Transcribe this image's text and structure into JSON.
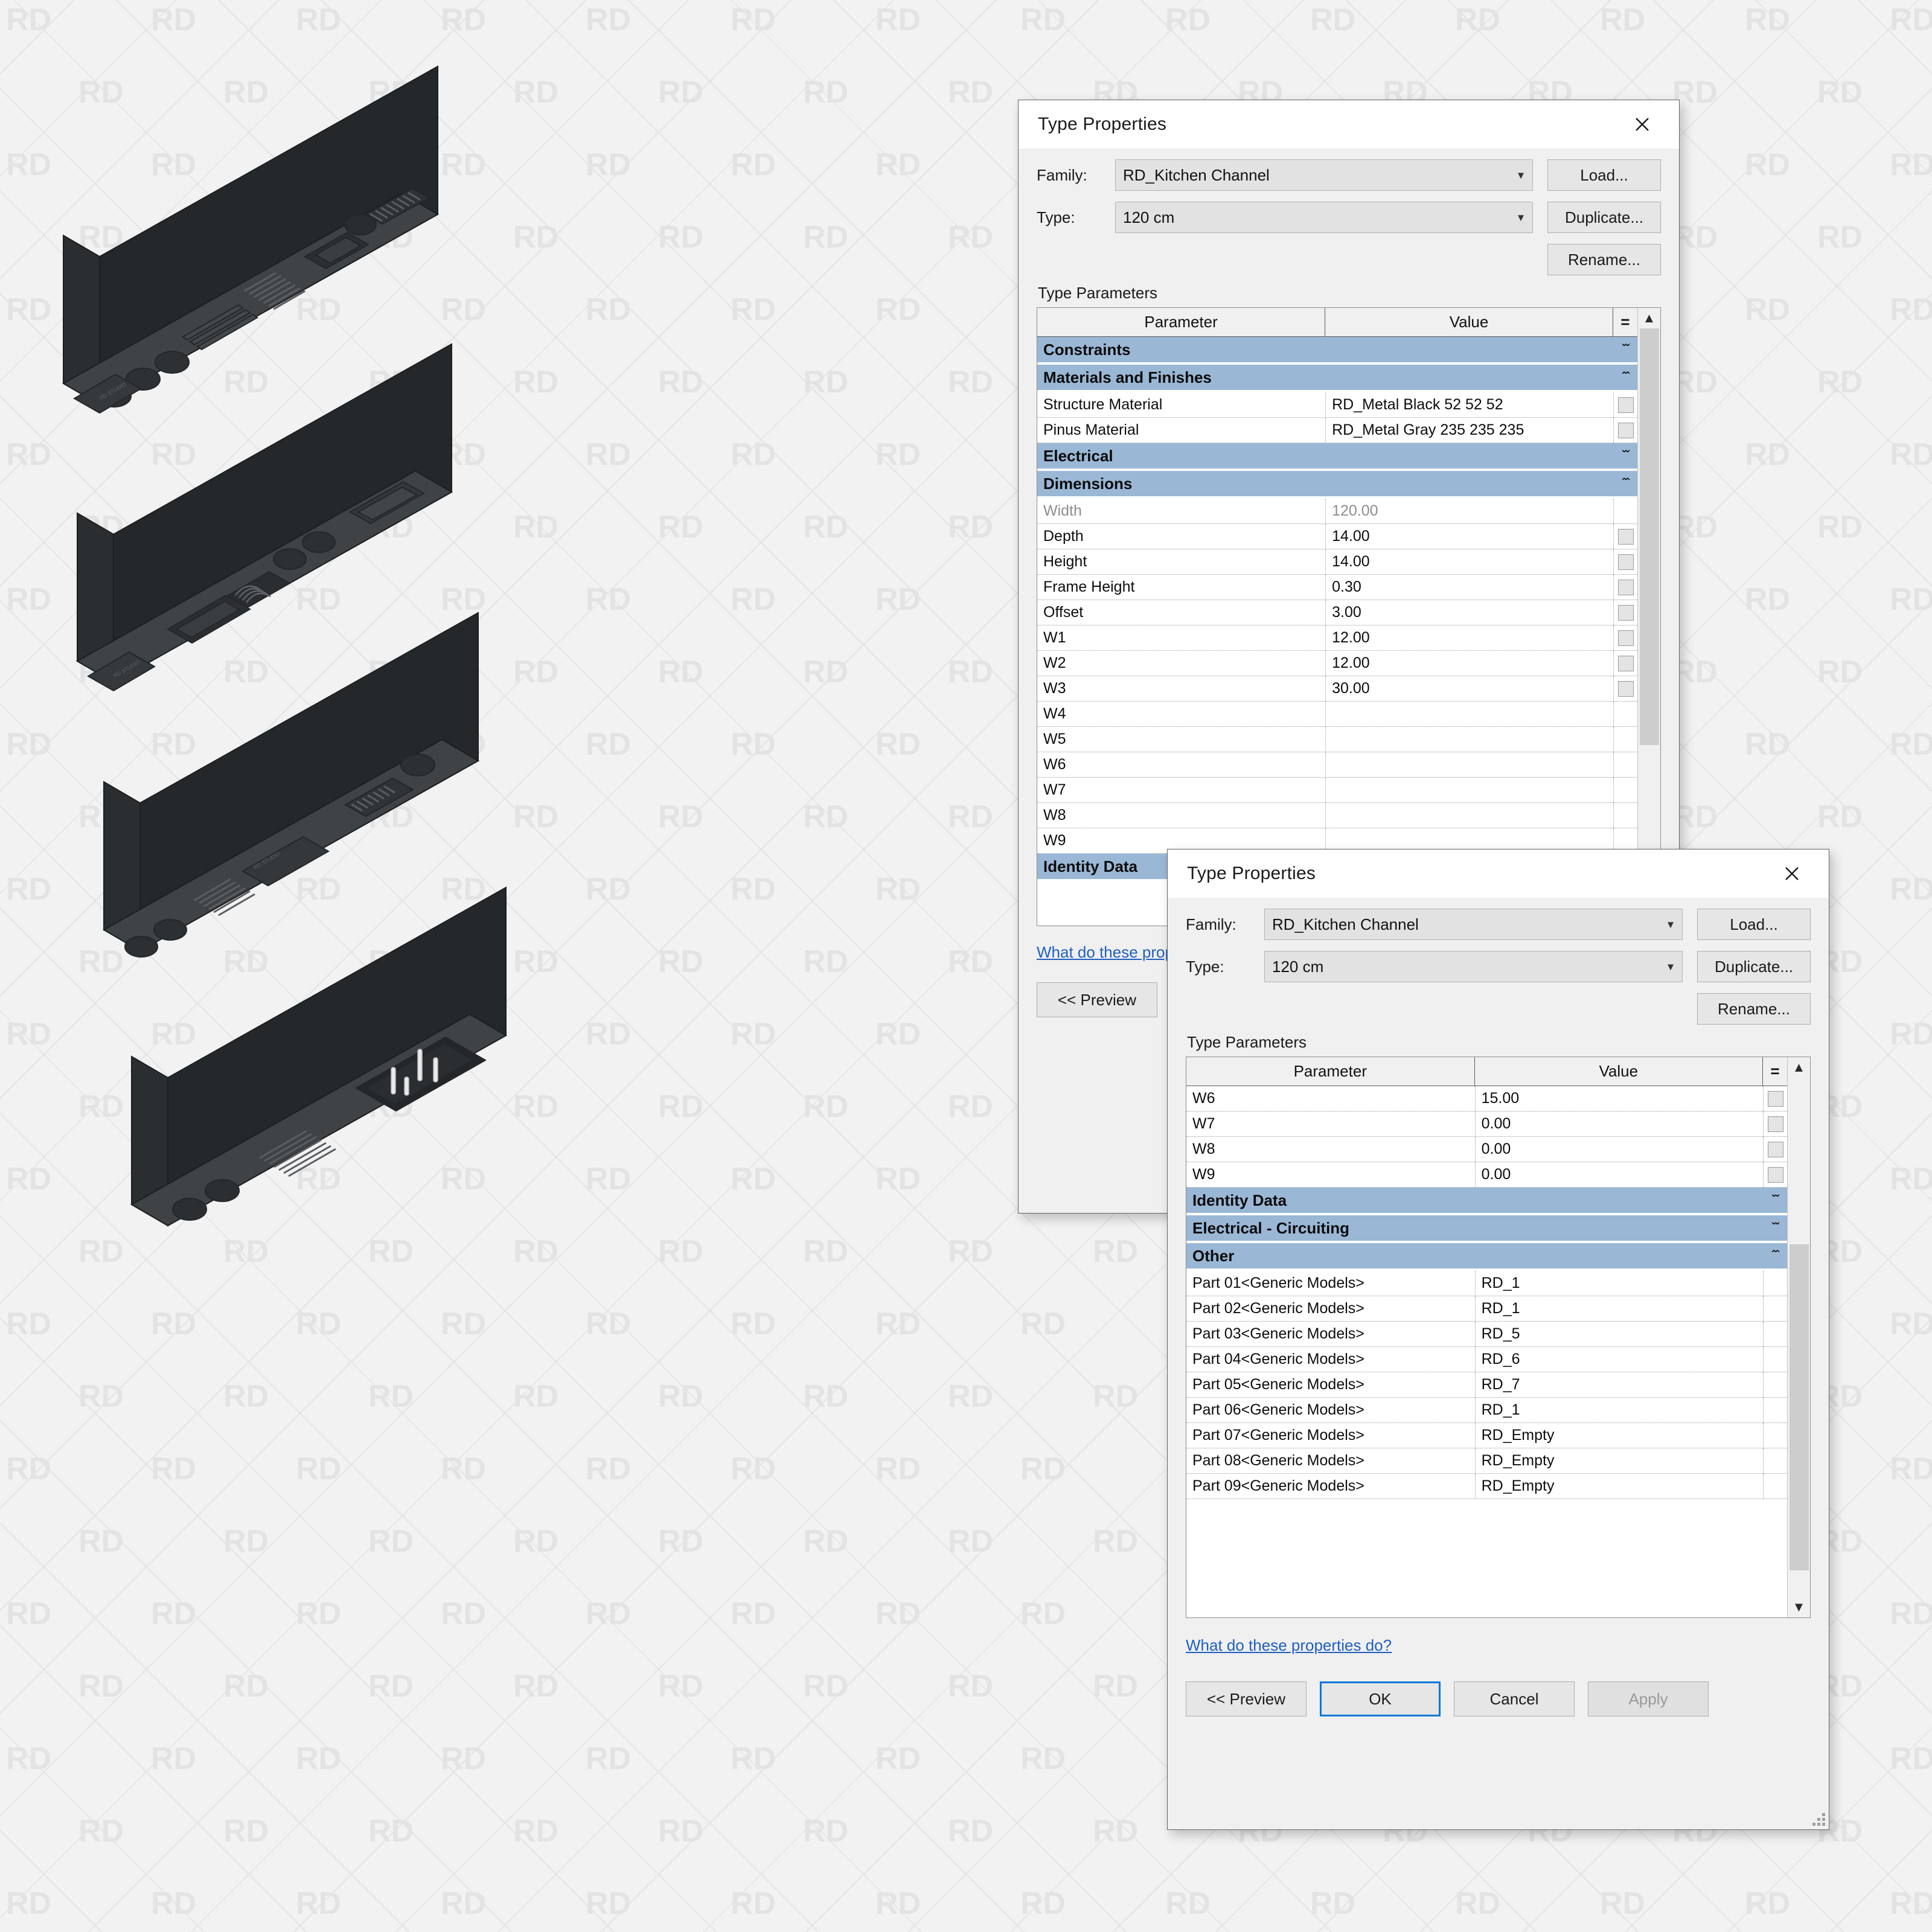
{
  "background": {
    "watermark_text": "RD",
    "watermark_color": "#e3e3e3"
  },
  "models": {
    "brand_label": "RD STUDIO",
    "count": 4,
    "body_color": "#3a3d40",
    "shadow_color": "#2b2e30"
  },
  "dialog1": {
    "title": "Type Properties",
    "close_label": "✕",
    "family_label": "Family:",
    "family_value": "RD_Kitchen Channel",
    "type_label": "Type:",
    "type_value": "120 cm",
    "load_label": "Load...",
    "duplicate_label": "Duplicate...",
    "rename_label": "Rename...",
    "type_parameters_caption": "Type Parameters",
    "col_parameter": "Parameter",
    "col_value": "Value",
    "col_eq": "=",
    "help_link": "What do these properties do?",
    "preview_label": "<< Preview",
    "rows": [
      {
        "kind": "group",
        "label": "Constraints",
        "chevs": "»"
      },
      {
        "kind": "group",
        "label": "Materials and Finishes",
        "chevs": "«"
      },
      {
        "kind": "data",
        "param": "Structure Material",
        "value": "RD_Metal Black 52 52 52",
        "eq": true
      },
      {
        "kind": "data",
        "param": "Pinus Material",
        "value": "RD_Metal Gray 235 235 235",
        "eq": true
      },
      {
        "kind": "group",
        "label": "Electrical",
        "chevs": "»"
      },
      {
        "kind": "group",
        "label": "Dimensions",
        "chevs": "«"
      },
      {
        "kind": "data",
        "param": "Width",
        "value": "120.00",
        "greyed": true,
        "eq": false
      },
      {
        "kind": "data",
        "param": "Depth",
        "value": "14.00",
        "eq": true
      },
      {
        "kind": "data",
        "param": "Height",
        "value": "14.00",
        "eq": true
      },
      {
        "kind": "data",
        "param": "Frame Height",
        "value": "0.30",
        "eq": true
      },
      {
        "kind": "data",
        "param": "Offset",
        "value": "3.00",
        "eq": true
      },
      {
        "kind": "data",
        "param": "W1",
        "value": "12.00",
        "eq": true
      },
      {
        "kind": "data",
        "param": "W2",
        "value": "12.00",
        "eq": true
      },
      {
        "kind": "data",
        "param": "W3",
        "value": "30.00",
        "eq": true
      },
      {
        "kind": "data",
        "param": "W4",
        "value": "",
        "eq": false
      },
      {
        "kind": "data",
        "param": "W5",
        "value": "",
        "eq": false
      },
      {
        "kind": "data",
        "param": "W6",
        "value": "",
        "eq": false
      },
      {
        "kind": "data",
        "param": "W7",
        "value": "",
        "eq": false
      },
      {
        "kind": "data",
        "param": "W8",
        "value": "",
        "eq": false
      },
      {
        "kind": "data",
        "param": "W9",
        "value": "",
        "eq": false
      },
      {
        "kind": "group",
        "label": "Identity Data",
        "chevs": "»"
      }
    ]
  },
  "dialog2": {
    "title": "Type Properties",
    "close_label": "✕",
    "family_label": "Family:",
    "family_value": "RD_Kitchen Channel",
    "type_label": "Type:",
    "type_value": "120 cm",
    "load_label": "Load...",
    "duplicate_label": "Duplicate...",
    "rename_label": "Rename...",
    "type_parameters_caption": "Type Parameters",
    "col_parameter": "Parameter",
    "col_value": "Value",
    "col_eq": "=",
    "help_link": "What do these properties do?",
    "preview_label": "<< Preview",
    "ok_label": "OK",
    "cancel_label": "Cancel",
    "apply_label": "Apply",
    "rows": [
      {
        "kind": "data",
        "param": "W6",
        "value": "15.00",
        "eq": true
      },
      {
        "kind": "data",
        "param": "W7",
        "value": "0.00",
        "eq": true
      },
      {
        "kind": "data",
        "param": "W8",
        "value": "0.00",
        "eq": true
      },
      {
        "kind": "data",
        "param": "W9",
        "value": "0.00",
        "eq": true
      },
      {
        "kind": "group",
        "label": "Identity Data",
        "chevs": "»"
      },
      {
        "kind": "group",
        "label": "Electrical - Circuiting",
        "chevs": "»"
      },
      {
        "kind": "group",
        "label": "Other",
        "chevs": "«"
      },
      {
        "kind": "data",
        "param": "Part 01<Generic Models>",
        "value": "RD_1",
        "eq": false
      },
      {
        "kind": "data",
        "param": "Part 02<Generic Models>",
        "value": "RD_1",
        "eq": false
      },
      {
        "kind": "data",
        "param": "Part 03<Generic Models>",
        "value": "RD_5",
        "eq": false
      },
      {
        "kind": "data",
        "param": "Part 04<Generic Models>",
        "value": "RD_6",
        "eq": false
      },
      {
        "kind": "data",
        "param": "Part 05<Generic Models>",
        "value": "RD_7",
        "eq": false
      },
      {
        "kind": "data",
        "param": "Part 06<Generic Models>",
        "value": "RD_1",
        "eq": false
      },
      {
        "kind": "data",
        "param": "Part 07<Generic Models>",
        "value": "RD_Empty",
        "eq": false
      },
      {
        "kind": "data",
        "param": "Part 08<Generic Models>",
        "value": "RD_Empty",
        "eq": false
      },
      {
        "kind": "data",
        "param": "Part 09<Generic Models>",
        "value": "RD_Empty",
        "eq": false
      }
    ]
  }
}
